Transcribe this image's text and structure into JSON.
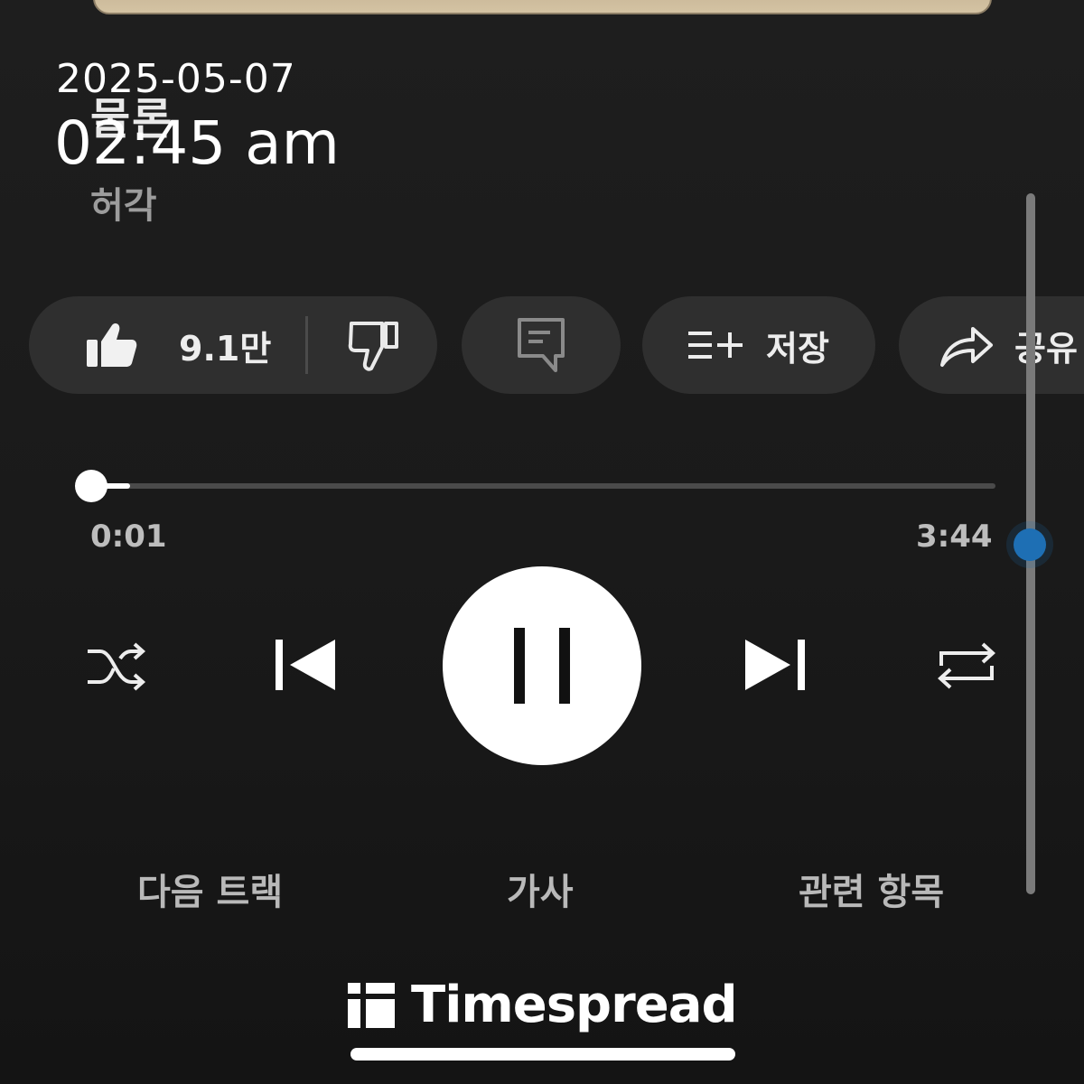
{
  "song": {
    "title": "물론",
    "artist": "허각"
  },
  "timestamp": {
    "date": "2025-05-07",
    "time": "02:45 am"
  },
  "actions": {
    "like_count": "9.1만",
    "save_label": "저장",
    "share_label": "공유"
  },
  "playback": {
    "elapsed": "0:01",
    "duration": "3:44",
    "progress_fraction": 0.0045,
    "state": "playing"
  },
  "bottom_tabs": [
    "다음 트랙",
    "가사",
    "관련 항목"
  ],
  "brand": {
    "name": "Timespread"
  },
  "icons": {
    "like": "thumbs-up-icon",
    "dislike": "thumbs-down-icon",
    "comment": "comment-icon",
    "save": "playlist-add-icon",
    "share": "share-arrow-icon",
    "shuffle": "shuffle-icon",
    "previous": "skip-previous-icon",
    "pause": "pause-icon",
    "next": "skip-next-icon",
    "repeat": "repeat-icon"
  },
  "colors": {
    "background": "#1a1a1a",
    "pill": "#2f2f2f",
    "accent": "#1e6fb4"
  }
}
